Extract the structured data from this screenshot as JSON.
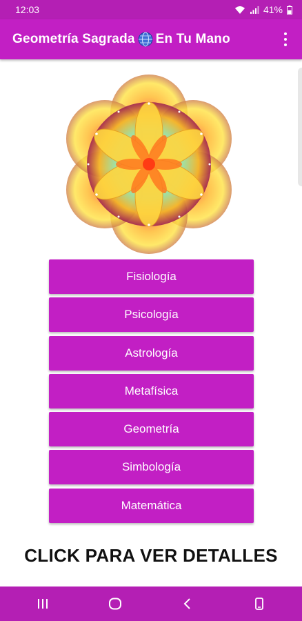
{
  "status_bar": {
    "time": "12:03",
    "battery": "41%",
    "icons": [
      "wifi-icon",
      "signal-icon",
      "battery-icon"
    ]
  },
  "app_bar": {
    "title_part1": "Geometría Sagrada",
    "title_part2": "En Tu Mano",
    "title_icon": "globe-icon",
    "menu_icon": "more-vert-icon"
  },
  "categories": [
    "Fisiología",
    "Psicología",
    "Astrología",
    "Metafísica",
    "Geometría",
    "Simbología",
    "Matemática"
  ],
  "cta_text": "CLICK PARA VER DETALLES",
  "nav_bar": {
    "icons": [
      "recent-apps-icon",
      "home-icon",
      "back-icon",
      "keyboard-toggle-icon"
    ]
  },
  "colors": {
    "primary": "#c21fc4",
    "status_bar": "#b41fb4",
    "button_text": "#ffffff",
    "cta_text": "#111111"
  }
}
